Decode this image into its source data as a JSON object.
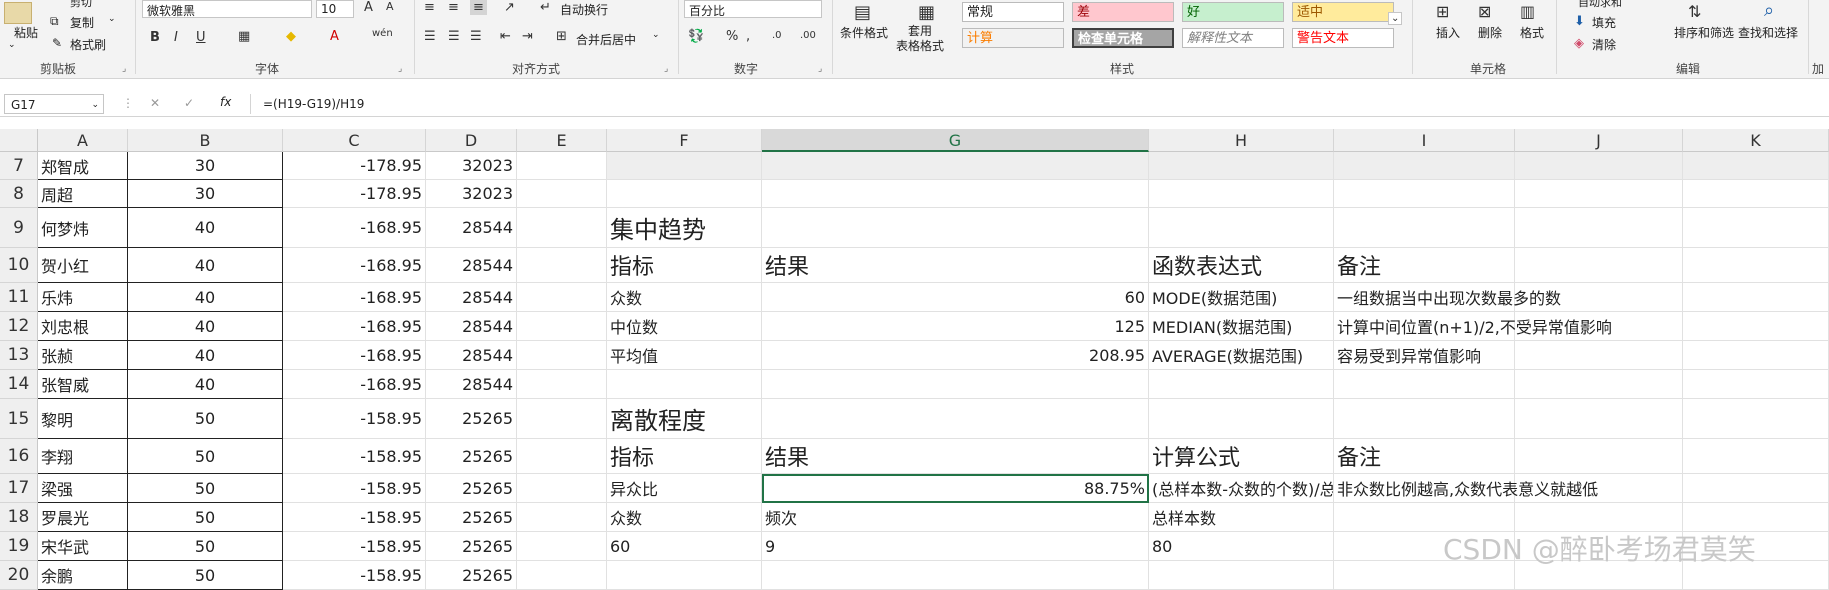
{
  "ribbon": {
    "clipboard": {
      "paste": "粘贴",
      "cut": "剪切",
      "copy": "复制",
      "format_painter": "格式刷",
      "label": "剪贴板"
    },
    "font": {
      "name": "微软雅黑",
      "size": "10",
      "label": "字体",
      "bold": "B",
      "italic": "I",
      "underline": "U",
      "grow": "A",
      "shrink": "A"
    },
    "alignment": {
      "wrap": "自动换行",
      "merge": "合并后居中",
      "label": "对齐方式"
    },
    "number": {
      "format": "百分比",
      "label": "数字"
    },
    "styles": {
      "conditional": "条件格式",
      "table_format": "套用\n表格格式",
      "label": "样式",
      "cells": [
        {
          "text": "常规",
          "bg": "#ffffff",
          "color": "#222222"
        },
        {
          "text": "差",
          "bg": "#ffc7ce",
          "color": "#9c0006"
        },
        {
          "text": "好",
          "bg": "#c6efce",
          "color": "#006100"
        },
        {
          "text": "适中",
          "bg": "#ffeb9c",
          "color": "#9c5700"
        },
        {
          "text": "计算",
          "bg": "#f2f2f2",
          "color": "#fa7d00"
        },
        {
          "text": "检查单元格",
          "bg": "#a5a5a5",
          "color": "#ffffff"
        },
        {
          "text": "解释性文本",
          "bg": "#ffffff",
          "color": "#7f7f7f"
        },
        {
          "text": "警告文本",
          "bg": "#ffffff",
          "color": "#ff0000"
        }
      ]
    },
    "cells_grp": {
      "insert": "插入",
      "delete": "删除",
      "format": "格式",
      "label": "单元格"
    },
    "editing": {
      "autosum": "自动求和",
      "fill": "填充",
      "clear": "清除",
      "sort": "排序和筛选",
      "find": "查找和选择",
      "label": "编辑",
      "extra": "加"
    }
  },
  "formula_bar": {
    "name_box": "G17",
    "cancel": "✕",
    "confirm": "✓",
    "fx": "fx",
    "formula": "=(H19-G19)/H19"
  },
  "columns": [
    "A",
    "B",
    "C",
    "D",
    "E",
    "F",
    "G",
    "H",
    "I",
    "J",
    "K"
  ],
  "rows": [
    {
      "num": "7",
      "a": "郑智成",
      "b": "30",
      "c": "-178.95",
      "d": "32023"
    },
    {
      "num": "8",
      "a": "周超",
      "b": "30",
      "c": "-178.95",
      "d": "32023"
    },
    {
      "num": "9",
      "a": "何梦炜",
      "b": "40",
      "c": "-168.95",
      "d": "28544"
    },
    {
      "num": "10",
      "a": "贺小红",
      "b": "40",
      "c": "-168.95",
      "d": "28544"
    },
    {
      "num": "11",
      "a": "乐炜",
      "b": "40",
      "c": "-168.95",
      "d": "28544"
    },
    {
      "num": "12",
      "a": "刘忠根",
      "b": "40",
      "c": "-168.95",
      "d": "28544"
    },
    {
      "num": "13",
      "a": "张赪",
      "b": "40",
      "c": "-168.95",
      "d": "28544"
    },
    {
      "num": "14",
      "a": "张智威",
      "b": "40",
      "c": "-168.95",
      "d": "28544"
    },
    {
      "num": "15",
      "a": "黎明",
      "b": "50",
      "c": "-158.95",
      "d": "25265"
    },
    {
      "num": "16",
      "a": "李翔",
      "b": "50",
      "c": "-158.95",
      "d": "25265"
    },
    {
      "num": "17",
      "a": "梁强",
      "b": "50",
      "c": "-158.95",
      "d": "25265"
    },
    {
      "num": "18",
      "a": "罗晨光",
      "b": "50",
      "c": "-158.95",
      "d": "25265"
    },
    {
      "num": "19",
      "a": "宋华武",
      "b": "50",
      "c": "-158.95",
      "d": "25265"
    },
    {
      "num": "20",
      "a": "余鹏",
      "b": "50",
      "c": "-158.95",
      "d": "25265"
    }
  ],
  "central": {
    "title": "集中趋势",
    "headers": [
      "指标",
      "结果",
      "函数表达式",
      "备注"
    ],
    "items": [
      {
        "name": "众数",
        "value": "60",
        "func": "MODE(数据范围)",
        "note": "一组数据当中出现次数最多的数"
      },
      {
        "name": "中位数",
        "value": "125",
        "func": "MEDIAN(数据范围)",
        "note": "计算中间位置(n+1)/2,不受异常值影响"
      },
      {
        "name": "平均值",
        "value": "208.95",
        "func": "AVERAGE(数据范围)",
        "note": "容易受到异常值影响"
      }
    ]
  },
  "dispersion": {
    "title": "离散程度",
    "headers": [
      "指标",
      "结果",
      "计算公式",
      "备注"
    ],
    "ratio": {
      "name": "异众比",
      "value": "88.75%",
      "formula": "(总样本数-众数的个数)/总",
      "note": "非众数比例越高,众数代表意义就越低"
    },
    "sub_headers": [
      "众数",
      "频次",
      "总样本数"
    ],
    "sub_values": [
      "60",
      "9",
      "80"
    ]
  },
  "watermark": "CSDN @醉卧考场君莫笑"
}
